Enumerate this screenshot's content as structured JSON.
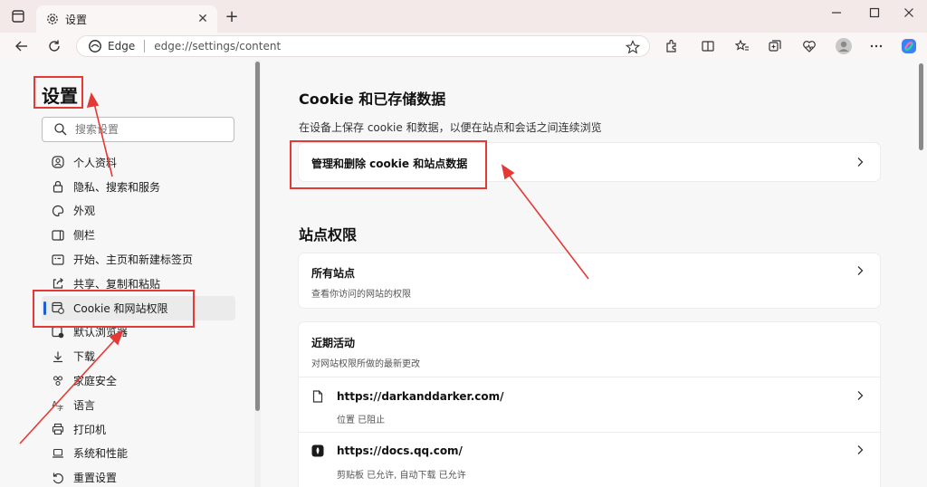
{
  "browser": {
    "tab_title": "设置",
    "address_label": "Edge",
    "url": "edge://settings/content"
  },
  "sidebar": {
    "title": "设置",
    "search_placeholder": "搜索设置",
    "items": [
      {
        "label": "个人资料",
        "icon": "profile-icon"
      },
      {
        "label": "隐私、搜索和服务",
        "icon": "lock-icon"
      },
      {
        "label": "外观",
        "icon": "appearance-icon"
      },
      {
        "label": "侧栏",
        "icon": "sidebar-icon"
      },
      {
        "label": "开始、主页和新建标签页",
        "icon": "home-icon"
      },
      {
        "label": "共享、复制和粘贴",
        "icon": "share-icon"
      },
      {
        "label": "Cookie 和网站权限",
        "icon": "cookie-icon",
        "active": true
      },
      {
        "label": "默认浏览器",
        "icon": "browser-icon"
      },
      {
        "label": "下载",
        "icon": "download-icon"
      },
      {
        "label": "家庭安全",
        "icon": "family-icon"
      },
      {
        "label": "语言",
        "icon": "language-icon"
      },
      {
        "label": "打印机",
        "icon": "printer-icon"
      },
      {
        "label": "系统和性能",
        "icon": "laptop-icon"
      },
      {
        "label": "重置设置",
        "icon": "reset-icon"
      }
    ]
  },
  "main": {
    "cookie_heading": "Cookie 和已存储数据",
    "cookie_desc": "在设备上保存 cookie 和数据，以便在站点和会话之间连续浏览",
    "manage_cookie_label": "管理和删除 cookie 和站点数据",
    "site_perm_heading": "站点权限",
    "all_sites": {
      "title": "所有站点",
      "subtitle": "查看你访问的网站的权限"
    },
    "recent": {
      "title": "近期活动",
      "subtitle": "对网站权限所做的最新更改",
      "sites": [
        {
          "url": "https://darkanddarker.com/",
          "detail": "位置 已阻止"
        },
        {
          "url": "https://docs.qq.com/",
          "detail": "剪贴板 已允许, 自动下载 已允许"
        }
      ]
    }
  },
  "colors": {
    "accent": "#1d5fd1",
    "annotation": "#e53935"
  }
}
